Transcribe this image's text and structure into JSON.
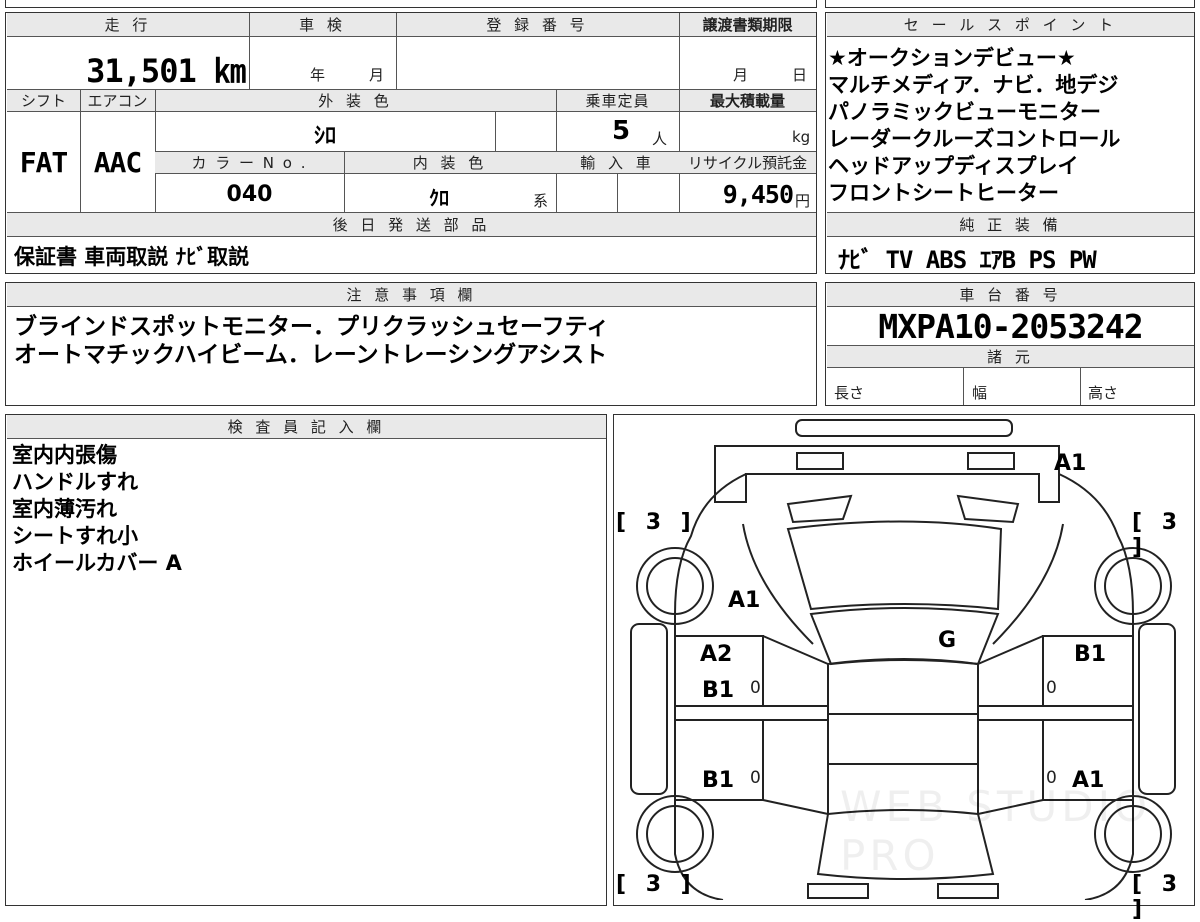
{
  "top": {
    "mileage_header": "走 行",
    "mileage": "31,501 ㎞",
    "inspection_header": "車 検",
    "inspection_year_unit": "年",
    "inspection_month_unit": "月",
    "registration_header": "登 録 番 号",
    "transfer_deadline_header": "譲渡書類期限",
    "transfer_month_unit": "月",
    "transfer_day_unit": "日",
    "shift_header": "シフト",
    "aircon_header": "エアコン",
    "shift": "FAT",
    "aircon": "AAC",
    "exterior_header": "外 装 色",
    "exterior": "ｼﾛ",
    "capacity_header": "乗車定員",
    "capacity": "5",
    "capacity_unit": "人",
    "max_load_header": "最大積載量",
    "max_load_unit": "kg",
    "color_no_header": "カ ラ ー N o .",
    "color_no": "040",
    "interior_header": "内 装 色",
    "interior": "ｸﾛ",
    "interior_suffix": "系",
    "import_header": "輸 入 車",
    "recycle_header": "リサイクル預託金",
    "recycle": "9,450",
    "recycle_unit": "円",
    "later_parts_header": "後 日 発 送 部 品",
    "later_parts": "保証書 車両取説 ﾅﾋﾞ取説"
  },
  "sales_points": {
    "header": "セ ー ル ス ポ イ ン ト",
    "lines": [
      "★オークションデビュー★",
      "マルチメディア．ナビ．地デジ",
      "パノラミックビューモニター",
      "レーダークルーズコントロール",
      "ヘッドアップディスプレイ",
      "フロントシートヒーター"
    ]
  },
  "genuine_equipment": {
    "header": "純 正 装 備",
    "value": "ﾅﾋﾞ TV ABS ｴｱB PS PW"
  },
  "notes": {
    "header": "注 意 事 項 欄",
    "lines": [
      "ブラインドスポットモニター．プリクラッシュセーフティ",
      "オートマチックハイビーム．レーントレーシングアシスト"
    ]
  },
  "chassis": {
    "header": "車 台 番 号",
    "value": "MXPA10-2053242",
    "spec_header": "諸 元",
    "length_label": "長さ",
    "width_label": "幅",
    "height_label": "高さ"
  },
  "inspector": {
    "header": "検 査 員 記 入 欄",
    "lines": [
      "室内内張傷",
      "ハンドルすれ",
      "室内薄汚れ",
      "シートすれ小",
      "ホイールカバー A"
    ]
  },
  "diagram": {
    "tire_tl": "[ 3 ]",
    "tire_tr": "[ 3 ]",
    "tire_bl": "[ 3 ]",
    "tire_br": "[ 3 ]",
    "front_bumper": "A1",
    "hood_left": "A1",
    "windshield": "G",
    "left_front_door_a": "A2",
    "left_front_door_b": "B1",
    "left_rear_door": "B1",
    "right_front_door": "B1",
    "right_rear_door": "A1",
    "tread_lf": "0",
    "tread_lr": "0",
    "tread_rf": "0",
    "tread_rr": "0",
    "watermark": "WEB STUDIO PRO"
  }
}
